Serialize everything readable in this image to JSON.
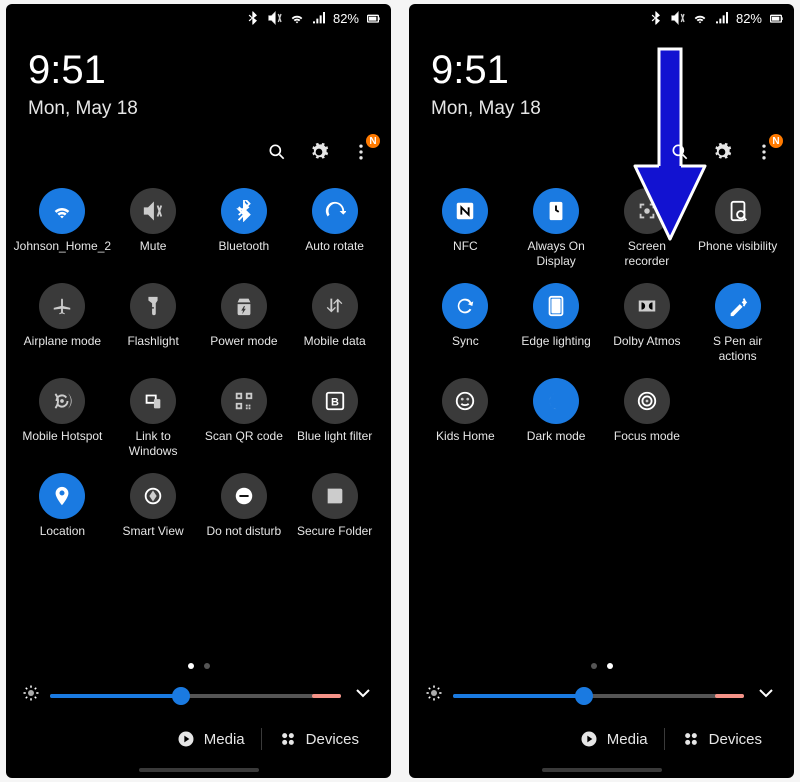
{
  "statusbar": {
    "battery_pct": "82%"
  },
  "datetime": {
    "time": "9:51",
    "date": "Mon, May 18"
  },
  "menu_badge": "N",
  "colors": {
    "accent": "#1a7ae1",
    "slider_warn": "#f59388"
  },
  "brightness": {
    "value_pct": 45,
    "warn_pct": 10
  },
  "bottom": {
    "media": "Media",
    "devices": "Devices"
  },
  "panels": [
    {
      "active_page": 0,
      "tiles": [
        {
          "name": "wifi",
          "label": "Johnson_Home_2",
          "icon": "wifi",
          "on": true
        },
        {
          "name": "mute",
          "label": "Mute",
          "icon": "mute",
          "on": false
        },
        {
          "name": "bluetooth",
          "label": "Bluetooth",
          "icon": "bluetooth",
          "on": true
        },
        {
          "name": "auto-rotate",
          "label": "Auto rotate",
          "icon": "rotate",
          "on": true
        },
        {
          "name": "airplane",
          "label": "Airplane mode",
          "icon": "airplane",
          "on": false
        },
        {
          "name": "flashlight",
          "label": "Flashlight",
          "icon": "flashlight",
          "on": false
        },
        {
          "name": "power-mode",
          "label": "Power mode",
          "icon": "power",
          "on": false
        },
        {
          "name": "mobile-data",
          "label": "Mobile data",
          "icon": "data",
          "on": false
        },
        {
          "name": "hotspot",
          "label": "Mobile Hotspot",
          "icon": "hotspot",
          "on": false
        },
        {
          "name": "link-windows",
          "label": "Link to Windows",
          "icon": "link",
          "on": false
        },
        {
          "name": "scan-qr",
          "label": "Scan QR code",
          "icon": "qr",
          "on": false
        },
        {
          "name": "blue-light",
          "label": "Blue light filter",
          "icon": "bluelight",
          "on": false
        },
        {
          "name": "location",
          "label": "Location",
          "icon": "location",
          "on": true
        },
        {
          "name": "smart-view",
          "label": "Smart View",
          "icon": "smartview",
          "on": false
        },
        {
          "name": "dnd",
          "label": "Do not disturb",
          "icon": "dnd",
          "on": false
        },
        {
          "name": "secure-folder",
          "label": "Secure Folder",
          "icon": "secure",
          "on": false
        }
      ]
    },
    {
      "active_page": 1,
      "arrow_overlay": true,
      "tiles": [
        {
          "name": "nfc",
          "label": "NFC",
          "icon": "nfc",
          "on": true
        },
        {
          "name": "always-on",
          "label": "Always On Display",
          "icon": "aod",
          "on": true
        },
        {
          "name": "screen-recorder",
          "label": "Screen recorder",
          "icon": "screenrec",
          "on": false
        },
        {
          "name": "phone-visibility",
          "label": "Phone visibility",
          "icon": "visibility",
          "on": false
        },
        {
          "name": "sync",
          "label": "Sync",
          "icon": "sync",
          "on": true
        },
        {
          "name": "edge-lighting",
          "label": "Edge lighting",
          "icon": "edge",
          "on": true
        },
        {
          "name": "dolby-atmos",
          "label": "Dolby Atmos",
          "icon": "dolby",
          "on": false
        },
        {
          "name": "spen",
          "label": "S Pen air actions",
          "icon": "spen",
          "on": true
        },
        {
          "name": "kids-home",
          "label": "Kids Home",
          "icon": "kids",
          "on": false
        },
        {
          "name": "dark-mode",
          "label": "Dark mode",
          "icon": "dark",
          "on": true
        },
        {
          "name": "focus-mode",
          "label": "Focus mode",
          "icon": "focus",
          "on": false
        }
      ]
    }
  ]
}
